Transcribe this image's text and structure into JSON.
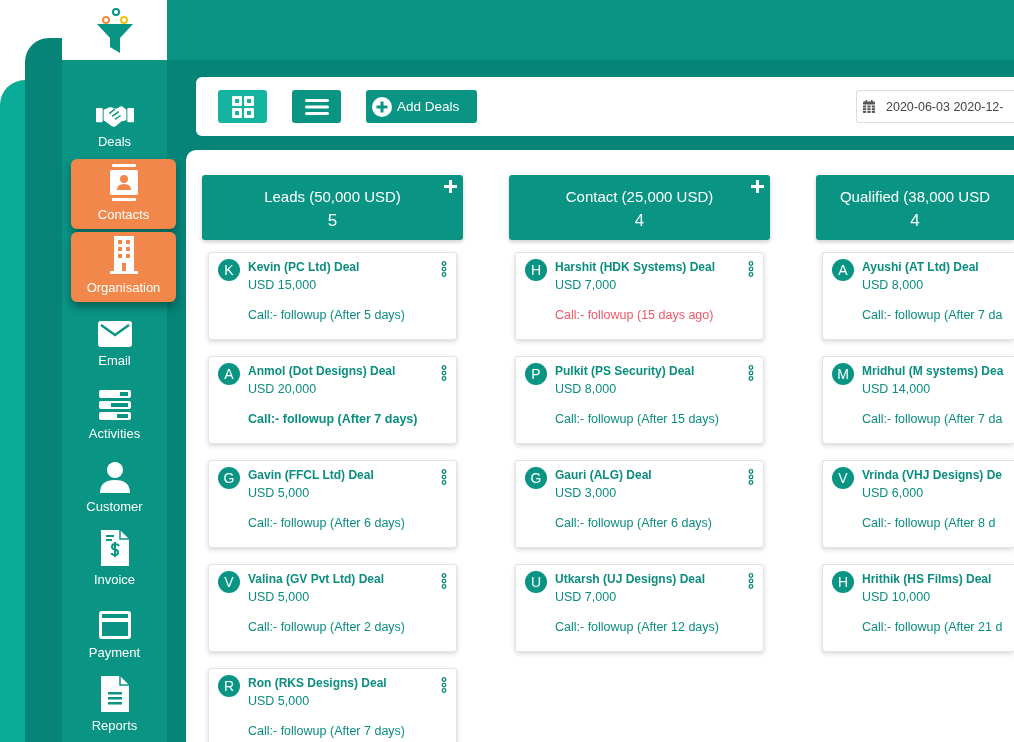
{
  "sidebar": {
    "items": [
      {
        "label": "Deals",
        "selected": false
      },
      {
        "label": "Contacts",
        "selected": true
      },
      {
        "label": "Organisation",
        "selected": true
      },
      {
        "label": "Email",
        "selected": false
      },
      {
        "label": "Activities",
        "selected": false
      },
      {
        "label": "Customer",
        "selected": false
      },
      {
        "label": "Invoice",
        "selected": false
      },
      {
        "label": "Payment",
        "selected": false
      },
      {
        "label": "Reports",
        "selected": false
      }
    ]
  },
  "toolbar": {
    "view_buttons": [
      {
        "kind": "grid",
        "selected": true
      },
      {
        "kind": "list",
        "selected": false
      }
    ],
    "add_button": {
      "label": "Add Deals"
    },
    "date_range": {
      "value": "2020-06-03 2020-12-"
    }
  },
  "board": {
    "columns": [
      {
        "title": "Leads (50,000 USD)",
        "count": "5",
        "show_icons": true,
        "deals": [
          {
            "initial": "K",
            "title": "Kevin (PC Ltd) Deal",
            "amount": "USD 15,000",
            "followup": "Call:- followup (After 5 days)",
            "overdue": false,
            "emphasized": false
          },
          {
            "initial": "A",
            "title": "Anmol (Dot Designs) Deal",
            "amount": "USD 20,000",
            "followup": "Call:- followup (After 7 days)",
            "overdue": false,
            "emphasized": true
          },
          {
            "initial": "G",
            "title": "Gavin (FFCL Ltd) Deal",
            "amount": "USD 5,000",
            "followup": "Call:- followup (After 6 days)",
            "overdue": false,
            "emphasized": false
          },
          {
            "initial": "V",
            "title": "Valina (GV Pvt Ltd) Deal",
            "amount": "USD 5,000",
            "followup": "Call:- followup (After 2 days)",
            "overdue": false,
            "emphasized": false
          },
          {
            "initial": "R",
            "title": "Ron (RKS Designs) Deal",
            "amount": "USD 5,000",
            "followup": "Call:- followup (After 7 days)",
            "overdue": false,
            "emphasized": false
          }
        ]
      },
      {
        "title": "Contact (25,000 USD)",
        "count": "4",
        "show_icons": true,
        "deals": [
          {
            "initial": "H",
            "title": "Harshit (HDK Systems) Deal",
            "amount": "USD 7,000",
            "followup": "Call:- followup (15 days ago)",
            "overdue": true,
            "emphasized": false
          },
          {
            "initial": "P",
            "title": "Pulkit (PS Security) Deal",
            "amount": "USD 8,000",
            "followup": "Call:- followup (After 15 days)",
            "overdue": false,
            "emphasized": false
          },
          {
            "initial": "G",
            "title": "Gauri (ALG) Deal",
            "amount": "USD 3,000",
            "followup": "Call:- followup (After 6 days)",
            "overdue": false,
            "emphasized": false
          },
          {
            "initial": "U",
            "title": "Utkarsh (UJ Designs) Deal",
            "amount": "USD 7,000",
            "followup": "Call:- followup (After 12 days)",
            "overdue": false,
            "emphasized": false
          }
        ]
      },
      {
        "title": "Qualified (38,000 USD",
        "count": "4",
        "show_icons": false,
        "deals": [
          {
            "initial": "A",
            "title": "Ayushi (AT Ltd) Deal",
            "amount": "USD 8,000",
            "followup": "Call:- followup (After 7 da",
            "overdue": false,
            "emphasized": false
          },
          {
            "initial": "M",
            "title": "Mridhul (M systems) Dea",
            "amount": "USD 14,000",
            "followup": "Call:- followup (After 7 da",
            "overdue": false,
            "emphasized": false
          },
          {
            "initial": "V",
            "title": "Vrinda (VHJ Designs) De",
            "amount": "USD 6,000",
            "followup": "Call:- followup (After 8 d",
            "overdue": false,
            "emphasized": false
          },
          {
            "initial": "H",
            "title": "Hrithik (HS Films) Deal",
            "amount": "USD 10,000",
            "followup": "Call:- followup (After 21 d",
            "overdue": false,
            "emphasized": false
          }
        ]
      }
    ]
  }
}
